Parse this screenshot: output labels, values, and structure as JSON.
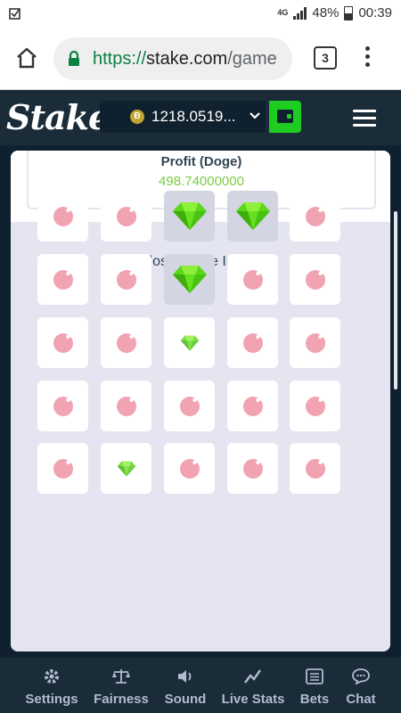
{
  "status_bar": {
    "network": "4G",
    "battery": "48%",
    "time": "00:39"
  },
  "browser": {
    "url_scheme": "https://",
    "url_host": "stake.com",
    "url_path": "/game",
    "tab_count": "3"
  },
  "header": {
    "logo": "Stake",
    "balance": "1218.0519...",
    "currency_symbol": "Ð",
    "accent_color": "#1fcc22"
  },
  "profit": {
    "label": "Profit (Doge)",
    "value": "498.74000000"
  },
  "game_info": {
    "toggle_label": "Close Game Info"
  },
  "grid": {
    "rows": [
      [
        {
          "type": "bomb",
          "revealed": false
        },
        {
          "type": "bomb",
          "revealed": false
        },
        {
          "type": "gem",
          "revealed": true
        },
        {
          "type": "gem",
          "revealed": true
        },
        {
          "type": "bomb",
          "revealed": false
        }
      ],
      [
        {
          "type": "bomb",
          "revealed": false
        },
        {
          "type": "bomb",
          "revealed": false
        },
        {
          "type": "gem",
          "revealed": true
        },
        {
          "type": "bomb",
          "revealed": false
        },
        {
          "type": "bomb",
          "revealed": false
        }
      ],
      [
        {
          "type": "bomb",
          "revealed": false
        },
        {
          "type": "bomb",
          "revealed": false
        },
        {
          "type": "gem",
          "revealed": false
        },
        {
          "type": "bomb",
          "revealed": false
        },
        {
          "type": "bomb",
          "revealed": false
        }
      ],
      [
        {
          "type": "bomb",
          "revealed": false
        },
        {
          "type": "bomb",
          "revealed": false
        },
        {
          "type": "bomb",
          "revealed": false
        },
        {
          "type": "bomb",
          "revealed": false
        },
        {
          "type": "bomb",
          "revealed": false
        }
      ],
      [
        {
          "type": "bomb",
          "revealed": false
        },
        {
          "type": "gem",
          "revealed": false
        },
        {
          "type": "bomb",
          "revealed": false
        },
        {
          "type": "bomb",
          "revealed": false
        },
        {
          "type": "bomb",
          "revealed": false
        }
      ]
    ]
  },
  "bottom_nav": {
    "items": [
      {
        "label": "Settings",
        "icon": "gear-icon"
      },
      {
        "label": "Fairness",
        "icon": "scales-icon"
      },
      {
        "label": "Sound",
        "icon": "speaker-icon"
      },
      {
        "label": "Live Stats",
        "icon": "stats-icon"
      },
      {
        "label": "Bets",
        "icon": "list-icon"
      },
      {
        "label": "Chat",
        "icon": "chat-icon"
      }
    ]
  }
}
